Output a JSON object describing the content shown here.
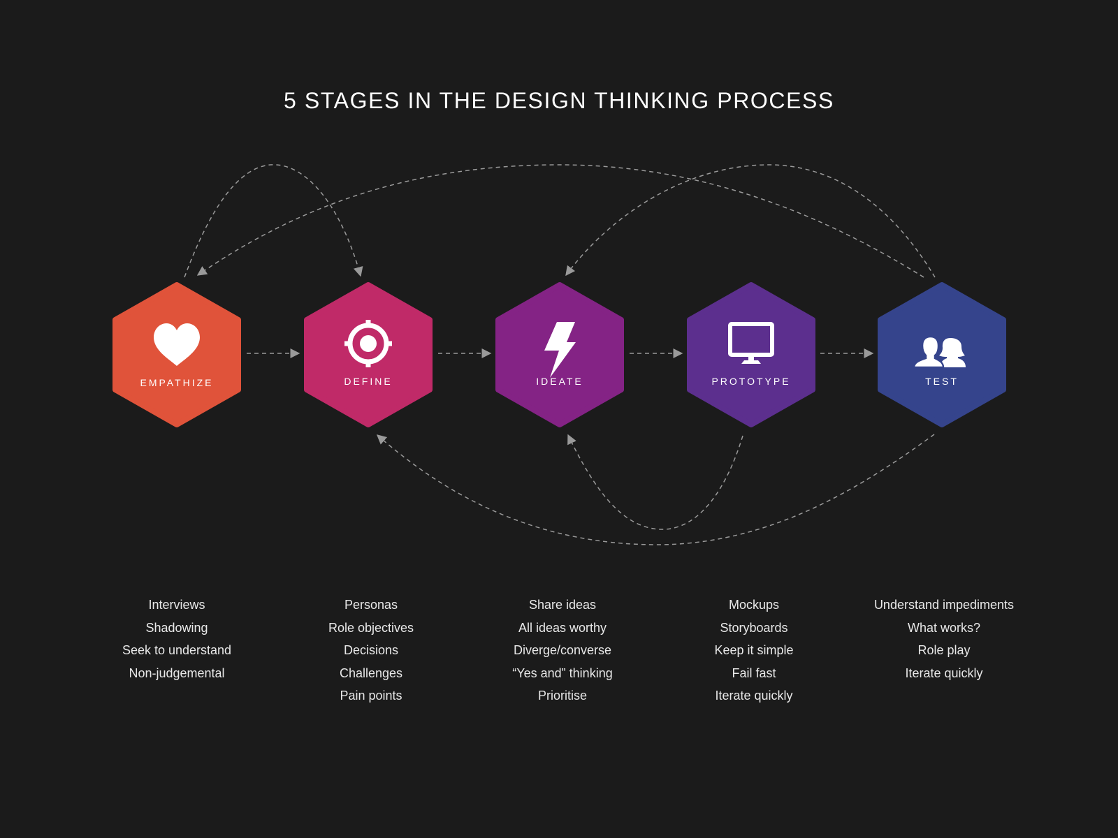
{
  "title": "5 STAGES IN THE DESIGN THINKING PROCESS",
  "connector_color": "#9a9a9a",
  "background": "#1b1b1b",
  "stages": [
    {
      "id": "empathize",
      "label": "EMPATHIZE",
      "icon": "heart-icon",
      "color": "#e0533a",
      "activities": [
        "Interviews",
        "Shadowing",
        "Seek to understand",
        "Non-judgemental"
      ]
    },
    {
      "id": "define",
      "label": "DEFINE",
      "icon": "target-icon",
      "color": "#c02a68",
      "activities": [
        "Personas",
        "Role objectives",
        "Decisions",
        "Challenges",
        "Pain points"
      ]
    },
    {
      "id": "ideate",
      "label": "IDEATE",
      "icon": "lightning-bolt-icon",
      "color": "#842385",
      "activities": [
        "Share ideas",
        "All ideas worthy",
        "Diverge/converse",
        "“Yes and” thinking",
        "Prioritise"
      ]
    },
    {
      "id": "prototype",
      "label": "PROTOTYPE",
      "icon": "monitor-icon",
      "color": "#5c2f8e",
      "activities": [
        "Mockups",
        "Storyboards",
        "Keep it simple",
        "Fail fast",
        "Iterate quickly"
      ]
    },
    {
      "id": "test",
      "label": "TEST",
      "icon": "users-icon",
      "color": "#35448c",
      "activities": [
        "Understand impediments",
        "What works?",
        "Role play",
        "Iterate quickly"
      ]
    }
  ],
  "flows": [
    {
      "from": "empathize",
      "to": "define",
      "type": "forward"
    },
    {
      "from": "define",
      "to": "ideate",
      "type": "forward"
    },
    {
      "from": "ideate",
      "to": "prototype",
      "type": "forward"
    },
    {
      "from": "prototype",
      "to": "test",
      "type": "forward"
    },
    {
      "from": "empathize",
      "to": "define",
      "type": "loop-top"
    },
    {
      "from": "test",
      "to": "empathize",
      "type": "loop-top"
    },
    {
      "from": "test",
      "to": "ideate",
      "type": "loop-top"
    },
    {
      "from": "prototype",
      "to": "ideate",
      "type": "loop-bottom"
    },
    {
      "from": "test",
      "to": "define",
      "type": "loop-bottom"
    }
  ]
}
